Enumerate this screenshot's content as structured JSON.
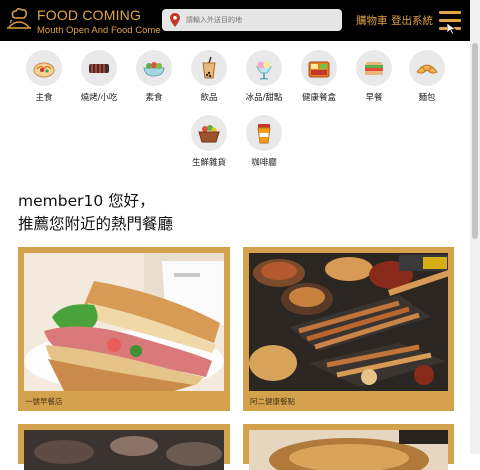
{
  "header": {
    "brand_title": "FOOD COMING",
    "brand_subtitle": "Mouth Open And Food Come",
    "search_placeholder": "請輸入外送目的地",
    "cart_label": "購物車",
    "logout_label": "登出系統"
  },
  "categories": [
    {
      "label": "主食",
      "icon": "noodle-bowl-icon"
    },
    {
      "label": "燒烤/小吃",
      "icon": "grill-icon"
    },
    {
      "label": "素食",
      "icon": "salad-icon"
    },
    {
      "label": "飲品",
      "icon": "bubble-tea-icon"
    },
    {
      "label": "冰品/甜點",
      "icon": "ice-cream-icon"
    },
    {
      "label": "健康餐盒",
      "icon": "bento-box-icon"
    },
    {
      "label": "早餐",
      "icon": "sandwich-icon"
    },
    {
      "label": "麵包",
      "icon": "croissant-icon"
    },
    {
      "label": "生鮮雜貨",
      "icon": "grocery-basket-icon"
    },
    {
      "label": "咖啡廳",
      "icon": "coffee-cup-icon"
    }
  ],
  "greeting": {
    "line1": "member10 您好，",
    "line2": "推薦您附近的熱門餐廳"
  },
  "restaurants": [
    {
      "name": "一號早餐店"
    },
    {
      "name": "阿二健康餐點"
    }
  ],
  "colors": {
    "header_bg": "#000000",
    "accent": "#e0a547",
    "card_border": "#d4a24c"
  }
}
